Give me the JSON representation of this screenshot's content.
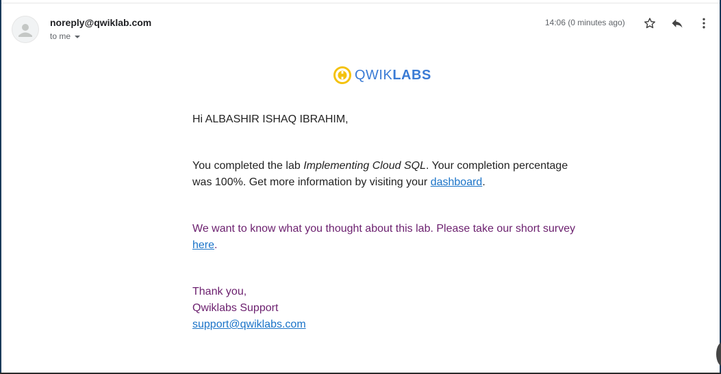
{
  "email": {
    "sender": "noreply@qwiklab.com",
    "to_label": "to me",
    "timestamp": "14:06 (0 minutes ago)"
  },
  "logo": {
    "brand_part1": "QWIK",
    "brand_part2": "LABS"
  },
  "body": {
    "greeting": "Hi ALBASHIR ISHAQ IBRAHIM,",
    "p1_prefix": "You completed the lab ",
    "lab_name": "Implementing Cloud SQL",
    "p1_middle": ". Your completion percentage was 100%. Get more information by visiting your ",
    "dashboard_link": "dashboard",
    "p1_suffix": ".",
    "p2_prefix": "We want to know what you thought about this lab. Please take our short survey ",
    "survey_link": "here",
    "p2_suffix": ".",
    "thanks": "Thank you,",
    "team": "Qwiklabs Support",
    "support_email": "support@qwiklabs.com"
  },
  "icons": {
    "star": "star-icon",
    "reply": "reply-icon",
    "more": "more-vert-icon",
    "avatar": "person-icon",
    "logo_mark": "qwiklabs-logo-icon"
  },
  "colors": {
    "link": "#1a73c8",
    "purple_text": "#6b1f6e",
    "logo_blue": "#3a7bd5",
    "logo_yellow": "#f4c20d"
  }
}
